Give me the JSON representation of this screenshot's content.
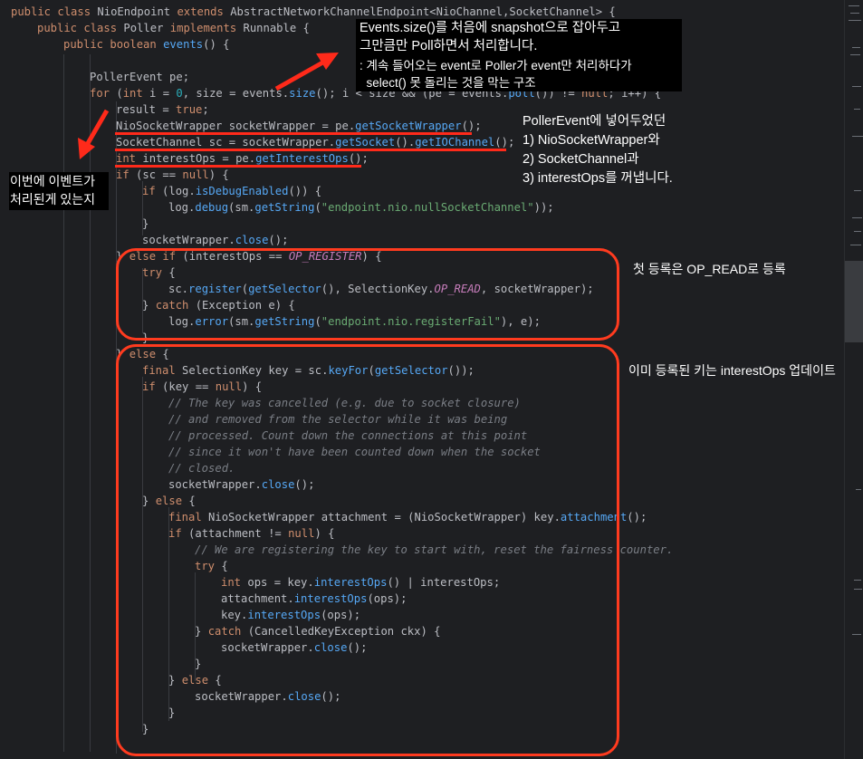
{
  "code": {
    "line1": {
      "k1": "public",
      "k2": "class",
      "name": "NioEndpoint",
      "k3": "extends",
      "sup": "AbstractNetworkChannelEndpoint<NioChannel,SocketChannel> {"
    },
    "line2": {
      "k1": "public",
      "k2": "class",
      "name": "Poller",
      "k3": "implements",
      "sup": "Runnable {"
    },
    "line3": {
      "k1": "public",
      "k2": "boolean",
      "fn": "events",
      "rest": "() {"
    },
    "line4": {
      "ty": "PollerEvent",
      "rest": " pe;"
    },
    "line5": {
      "a": "for",
      "b": " (",
      "c": "int",
      "d": " i = ",
      "e": "0",
      ",": ", size = events.",
      "f": "size",
      "g": "(); i < size && (pe = events.",
      "h": "poll",
      "i": "()) != ",
      "j": "null",
      "k": "; i++) {"
    },
    "line6": {
      "a": "result = ",
      "b": "true",
      "c": ";"
    },
    "line7": {
      "ty": "NioSocketWrapper",
      "a": " socketWrapper = pe.",
      "fn": "getSocketWrapper",
      "b": "();"
    },
    "line8": {
      "ty": "SocketChannel",
      "a": " sc = socketWrapper.",
      "fn1": "getSocket",
      "b": "().",
      "fn2": "getIOChannel",
      "c": "();"
    },
    "line9": {
      "k": "int",
      "a": " interestOps = pe.",
      "fn": "getInterestOps",
      "b": "();"
    },
    "line10": {
      "k": "if",
      "a": " (sc == ",
      "n": "null",
      ") {": ") {"
    },
    "line11": {
      "k": "if",
      "a": " (log.",
      "fn": "isDebugEnabled",
      "b": "()) {"
    },
    "line12": {
      "a": "log.",
      "fn": "debug",
      "b": "(sm.",
      "fn2": "getString",
      "c": "(",
      "s": "\"endpoint.nio.nullSocketChannel\"",
      "d": "));"
    },
    "line13": {
      "a": "}"
    },
    "line14": {
      "a": "socketWrapper.",
      "fn": "close",
      "b": "();"
    },
    "line15": {
      "a": "} ",
      "k1": "else",
      "k2": " if",
      "b": " (interestOps == ",
      "c": "OP_REGISTER",
      ") {": ") {"
    },
    "line16": {
      "k": "try",
      "a": " {"
    },
    "line17": {
      "a": "sc.",
      "fn": "register",
      "b": "(",
      "fn2": "getSelector",
      "c": "(), SelectionKey.",
      "cst": "OP_READ",
      "d": ", socketWrapper);"
    },
    "line18": {
      "a": "} ",
      "k": "catch",
      "b": " (Exception e) {"
    },
    "line19": {
      "a": "log.",
      "fn": "error",
      "b": "(sm.",
      "fn2": "getString",
      "c": "(",
      "s": "\"endpoint.nio.registerFail\"",
      "d": "), e);"
    },
    "line20": {
      "a": "}"
    },
    "line21": {
      "a": "} ",
      "k": "else",
      "b": " {"
    },
    "line22": {
      "k": "final",
      "a": " SelectionKey key = sc.",
      "fn": "keyFor",
      "b": "(",
      "fn2": "getSelector",
      "c": "());"
    },
    "line23": {
      "k": "if",
      "a": " (key == ",
      "n": "null",
      ") {": ") {"
    },
    "line24": "// The key was cancelled (e.g. due to socket closure)",
    "line25": "// and removed from the selector while it was being",
    "line26": "// processed. Count down the connections at this point",
    "line27": "// since it won't have been counted down when the socket",
    "line28": "// closed.",
    "line29": {
      "a": "socketWrapper.",
      "fn": "close",
      "b": "();"
    },
    "line30": {
      "a": "} ",
      "k": "else",
      "b": " {"
    },
    "line31": {
      "k": "final",
      "a": " NioSocketWrapper attachment = (NioSocketWrapper) key.",
      "fn": "attachment",
      "b": "();"
    },
    "line32": {
      "k": "if",
      "a": " (attachment != ",
      "n": "null",
      ") {": ") {"
    },
    "line33": "// We are registering the key to start with, reset the fairness counter.",
    "line34": {
      "k": "try",
      "a": " {"
    },
    "line35": {
      "k": "int",
      "a": " ops = key.",
      "fn": "interestOps",
      "b": "() | interestOps;"
    },
    "line36": {
      "a": "attachment.",
      "fn": "interestOps",
      "b": "(ops);"
    },
    "line37": {
      "a": "key.",
      "fn": "interestOps",
      "b": "(ops);"
    },
    "line38": {
      "a": "} ",
      "k": "catch",
      "b": " (CancelledKeyException ckx) {"
    },
    "line39": {
      "a": "socketWrapper.",
      "fn": "close",
      "b": "();"
    },
    "line40": {
      "a": "}"
    },
    "line41": {
      "a": "} ",
      "k": "else",
      "b": " {"
    },
    "line42": {
      "a": "socketWrapper.",
      "fn": "close",
      "b": "();"
    },
    "line43": {
      "a": "}"
    },
    "line44": {
      "a": "}"
    }
  },
  "notes": {
    "top_1": "Events.size()를 처음에 snapshot으로 잡아두고",
    "top_2": "그만큼만 Poll하면서 처리합니다.",
    "top_3": ": 계속 들어오는 event로 Poller가 event만 처리하다가",
    "top_4": "  select() 못 돌리는 것을 막는 구조",
    "left_1": "이번에 이벤트가",
    "left_2": "처리된게 있는지",
    "right_1": "PollerEvent에 넣어두었던",
    "right_2": "1) NioSocketWrapper와",
    "right_3": "2) SocketChannel과",
    "right_4": "3) interestOps를 꺼냅니다.",
    "register": "첫 등록은 OP_READ로 등록",
    "update": "이미 등록된 키는 interestOps 업데이트"
  },
  "colors": {
    "background": "#1e1f22",
    "keyword": "#cf8e6d",
    "function": "#56a8f5",
    "string": "#6aab73",
    "comment": "#7a7e85",
    "constant": "#c77dbb",
    "number": "#2aacb8",
    "annotation": "#ff3b1f"
  }
}
